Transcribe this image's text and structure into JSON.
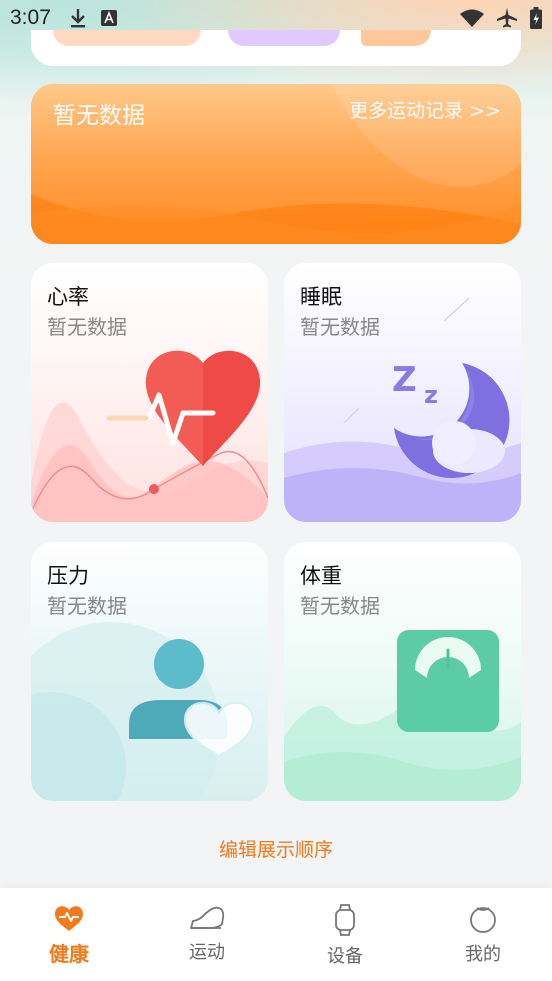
{
  "status_bar": {
    "time": "3:07",
    "icons": [
      "download-icon",
      "text-a-icon",
      "wifi-icon",
      "airplane-icon",
      "battery-icon"
    ]
  },
  "exercise_card": {
    "empty_text": "暂无数据",
    "more_link": "更多运动记录 >>"
  },
  "tiles": [
    {
      "title": "心率",
      "subtitle": "暂无数据"
    },
    {
      "title": "睡眠",
      "subtitle": "暂无数据"
    },
    {
      "title": "压力",
      "subtitle": "暂无数据"
    },
    {
      "title": "体重",
      "subtitle": "暂无数据"
    }
  ],
  "edit_order": "编辑展示顺序",
  "bottom_nav": {
    "items": [
      {
        "label": "健康",
        "icon": "heart-pulse-icon",
        "active": true
      },
      {
        "label": "运动",
        "icon": "sneaker-icon",
        "active": false
      },
      {
        "label": "设备",
        "icon": "watch-icon",
        "active": false
      },
      {
        "label": "我的",
        "icon": "profile-icon",
        "active": false
      }
    ]
  },
  "colors": {
    "accent": "#f07a1c",
    "exercise_gradient": [
      "#ffc98a",
      "#ff8a1f"
    ]
  }
}
